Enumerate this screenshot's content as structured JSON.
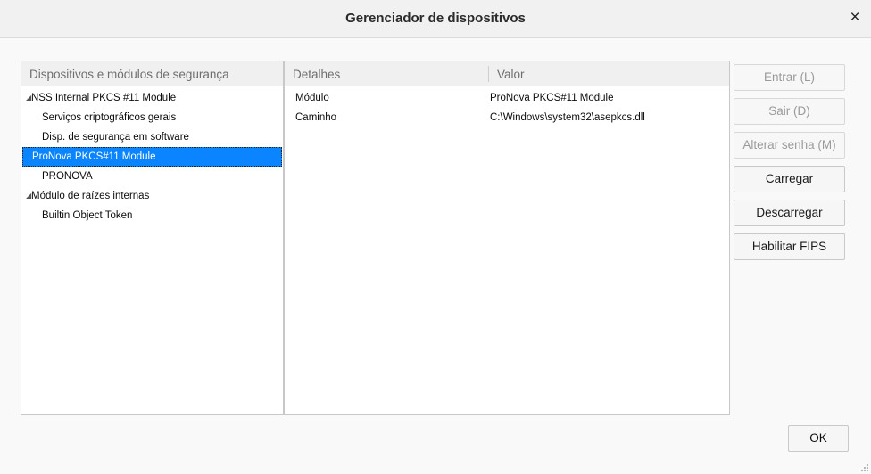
{
  "window": {
    "title": "Gerenciador de dispositivos",
    "close_glyph": "×"
  },
  "tree": {
    "header": "Dispositivos e módulos de segurança",
    "items": [
      {
        "label": "NSS Internal PKCS #11 Module",
        "level": 0,
        "expanded": true
      },
      {
        "label": "Serviços criptográficos gerais",
        "level": 1
      },
      {
        "label": "Disp. de segurança em software",
        "level": 1
      },
      {
        "label": "ProNova PKCS#11 Module",
        "level": 0,
        "selected": true
      },
      {
        "label": "PRONOVA",
        "level": 1
      },
      {
        "label": "Módulo de raízes internas",
        "level": 0,
        "expanded": true
      },
      {
        "label": "Builtin Object Token",
        "level": 1
      }
    ]
  },
  "details": {
    "col_details": "Detalhes",
    "col_value": "Valor",
    "rows": [
      {
        "name": "Módulo",
        "value": "ProNova PKCS#11 Module"
      },
      {
        "name": "Caminho",
        "value": "C:\\Windows\\system32\\asepkcs.dll"
      }
    ]
  },
  "buttons": {
    "login": "Entrar (L)",
    "logout": "Sair (D)",
    "change_password": "Alterar senha (M)",
    "load": "Carregar",
    "unload": "Descarregar",
    "enable_fips": "Habilitar FIPS",
    "ok": "OK"
  },
  "colors": {
    "selection": "#0a84ff"
  }
}
